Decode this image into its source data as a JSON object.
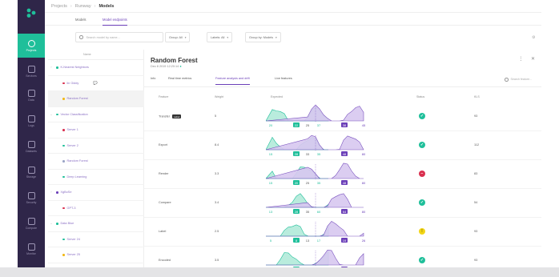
{
  "colors": {
    "sidebar": "#2f2649",
    "accent_green": "#1fbf9a",
    "accent_purple": "#6b3fb8",
    "error": "#d9304f",
    "warning": "#f2d516"
  },
  "breadcrumb": [
    "Projects",
    "Runway",
    "Models"
  ],
  "sidebar": {
    "items": [
      {
        "label": "Projects",
        "active": true
      },
      {
        "label": "Services"
      },
      {
        "label": "Data"
      },
      {
        "label": "Logs"
      },
      {
        "label": "Datasets"
      },
      {
        "label": "Storage"
      },
      {
        "label": "Security"
      },
      {
        "label": "Compute"
      },
      {
        "label": "Monitor"
      }
    ]
  },
  "tabs": [
    "Models",
    "Model endpoints"
  ],
  "filters": {
    "search_placeholder": "Search model by name...",
    "group": "Group: All",
    "labels": "Labels: All",
    "group_by": "Group by: Models"
  },
  "tree": {
    "header": "Name",
    "items": [
      {
        "label": "K-Nearest Neighbors",
        "dot": "#1fbf9a",
        "chev": "›"
      },
      {
        "label": "lin Giddy",
        "dot": "#d9304f"
      },
      {
        "label": "Random Forest",
        "dot": "#f2b816",
        "selected": true
      },
      {
        "label": "Vector Classification",
        "dot": "#1fbf9a",
        "chev": "⌄"
      },
      {
        "label": "Server 1",
        "dot": "#d9304f"
      },
      {
        "label": "Server 2",
        "dot": "#1fbf9a"
      },
      {
        "label": "Random Forest",
        "dot": "#9aa4c6"
      },
      {
        "label": "Deep Learning",
        "dot": "#1fbf9a"
      },
      {
        "label": "XgBoSe",
        "dot": "#6b3fb8",
        "chev": "›"
      },
      {
        "label": "GPT-3",
        "dot": "#d9304f"
      },
      {
        "label": "Data Blue",
        "dot": "#1fbf9a",
        "chev": "⌄"
      },
      {
        "label": "Server 24",
        "dot": "#1fbf9a"
      },
      {
        "label": "Server 25",
        "dot": "#f2b816"
      }
    ]
  },
  "detail": {
    "title": "Random Forest",
    "subtitle": "Dec 8 2019 12:20:14",
    "tabs": [
      "Info",
      "Real time metrics",
      "Feature analysis and drift",
      "Live features"
    ],
    "search_placeholder": "Search feature...",
    "columns": [
      "Feature",
      "Weight",
      "Expected",
      "Status",
      "KLS"
    ],
    "rows": [
      {
        "feature": "Transfer",
        "badge": "Label",
        "weight": "5",
        "status": "ok",
        "kls": "93",
        "lo": "20",
        "val1": "22",
        "val2": "25",
        "val3": "37",
        "val4": "38",
        "hi": "45"
      },
      {
        "feature": "Export",
        "weight": "8.4",
        "status": "ok",
        "kls": "112",
        "lo": "15",
        "val1": "28",
        "val2": "33",
        "val3": "35",
        "val4": "48",
        "hi": "80"
      },
      {
        "feature": "Render",
        "weight": "3.3",
        "status": "error",
        "kls": "83",
        "lo": "15",
        "val1": "20",
        "val2": "25",
        "val3": "35",
        "val4": "48",
        "hi": "80"
      },
      {
        "feature": "Compare",
        "weight": "3.4",
        "status": "ok",
        "kls": "54",
        "lo": "13",
        "val1": "28",
        "val2": "35",
        "val3": "60",
        "val4": "64",
        "hi": "80"
      },
      {
        "feature": "Label",
        "weight": "2.5",
        "status": "warn",
        "kls": "93",
        "lo": "5",
        "val1": "8",
        "val2": "13",
        "val3": "17",
        "val4": "19",
        "hi": "26"
      },
      {
        "feature": "Encoded",
        "weight": "3.5",
        "status": "ok",
        "kls": "93",
        "lo": "11",
        "val1": "22",
        "val2": "25",
        "val3": "27",
        "val4": "28",
        "hi": "35"
      }
    ]
  }
}
